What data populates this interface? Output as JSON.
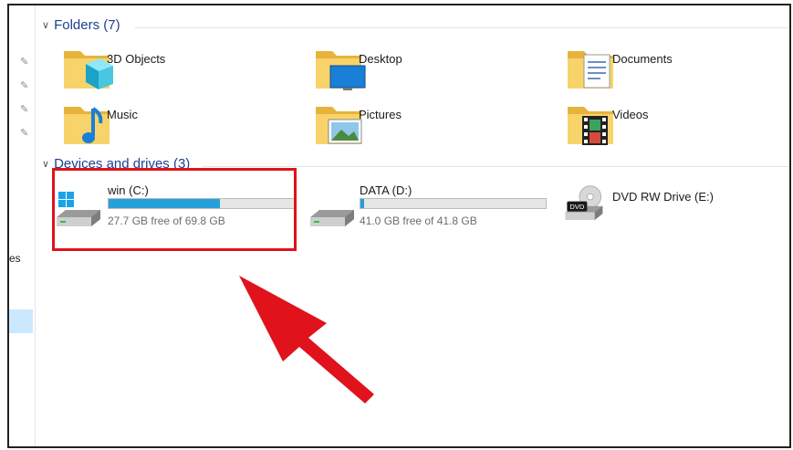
{
  "folders_group": {
    "title": "Folders (7)",
    "items": [
      {
        "label": "3D Objects",
        "icon": "3d-objects-icon"
      },
      {
        "label": "Desktop",
        "icon": "desktop-icon"
      },
      {
        "label": "Documents",
        "icon": "documents-icon"
      },
      {
        "label": "Music",
        "icon": "music-icon"
      },
      {
        "label": "Pictures",
        "icon": "pictures-icon"
      },
      {
        "label": "Videos",
        "icon": "videos-icon"
      }
    ]
  },
  "drives_group": {
    "title": "Devices and drives (3)",
    "items": [
      {
        "name": "win (C:)",
        "free_text": "27.7 GB free of 69.8 GB",
        "used_fraction": 0.6
      },
      {
        "name": "DATA (D:)",
        "free_text": "41.0 GB free of 41.8 GB",
        "used_fraction": 0.02
      },
      {
        "name": "DVD RW Drive (E:)",
        "badge": "DVD"
      }
    ]
  },
  "left_pane": {
    "fragment": "es"
  },
  "colors": {
    "accent": "#26a0da",
    "highlight": "#e0121b",
    "header": "#1e3f8f"
  }
}
